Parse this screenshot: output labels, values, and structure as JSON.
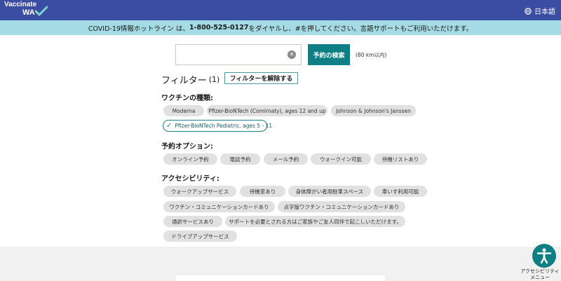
{
  "header": {
    "logo_line1": "Vaccinate",
    "logo_line2": "WA",
    "language_label": "日本語",
    "language_icon": "globe-icon"
  },
  "hotline": {
    "prefix": "COVID-19情報ホットライン は、",
    "number": "1-800-525-0127",
    "suffix": "をダイヤルし、#を押してください。言語サポートもご利用いただけます。"
  },
  "search": {
    "value": "",
    "placeholder": "",
    "clear_icon": "clear-icon",
    "button_label": "予約の検索",
    "radius_label": "(80 km以内)"
  },
  "filters": {
    "title": "フィルター",
    "count": "(1)",
    "clear_label": "フィルターを解除する"
  },
  "vaccine_types": {
    "label": "ワクチンの種類:",
    "options": [
      {
        "label": "Moderna",
        "selected": false
      },
      {
        "label": "Pfizer-BioNTech (Comirnaty), ages 12 and up",
        "selected": false
      },
      {
        "label": "Johnson & Johnson's Janssen",
        "selected": false
      },
      {
        "label": "Pfizer-BioNTech Pediatric, ages 5 - 11",
        "selected": true
      }
    ]
  },
  "appointment_options": {
    "label": "予約オプション:",
    "options": [
      "オンライン予約",
      "電話予約",
      "メール予約",
      "ウォークイン可能",
      "待機リストあり"
    ]
  },
  "accessibility": {
    "label": "アクセシビリティ:",
    "options": [
      "ウォークアップサービス",
      "待機室あり",
      "身体障がい者用駐車スペース",
      "車いす利用可能",
      "ワクチン・コミュニケーションカードあり",
      "点字版ワクチン・コミュニケーションカードあり",
      "通訳サービスあり",
      "サポートを必要とされる方はご家族やご友人同伴で起こしいただけます。",
      "ドライブアップサービス"
    ]
  },
  "a11y_menu": {
    "icon": "accessibility-icon",
    "label_line1": "アクセシビリティ",
    "label_line2": "メニュー"
  },
  "colors": {
    "header_bg": "#3b4ca3",
    "hotline_bg": "#a5dbe4",
    "accent": "#0e7f84",
    "chip_bg": "#e1e1e1"
  }
}
